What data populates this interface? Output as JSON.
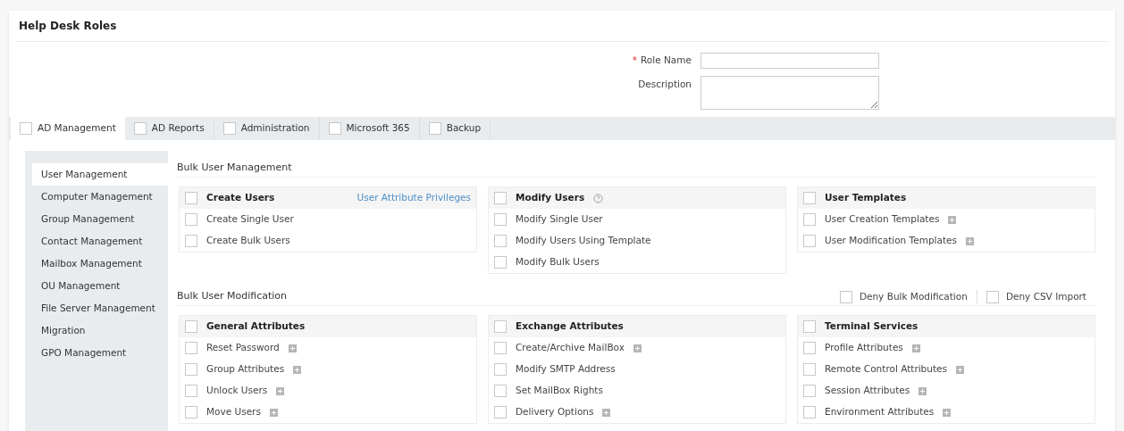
{
  "page_title": "Help Desk Roles",
  "form": {
    "role_name": {
      "label": "Role Name",
      "required_mark": "*"
    },
    "description": {
      "label": "Description"
    }
  },
  "tabs": [
    {
      "label": "AD Management",
      "selected": true,
      "checked": false
    },
    {
      "label": "AD Reports",
      "selected": false,
      "checked": false
    },
    {
      "label": "Administration",
      "selected": false,
      "checked": false
    },
    {
      "label": "Microsoft 365",
      "selected": false,
      "checked": false
    },
    {
      "label": "Backup",
      "selected": false,
      "checked": false
    }
  ],
  "sidebar": {
    "items": [
      {
        "label": "User Management",
        "selected": true
      },
      {
        "label": "Computer Management",
        "selected": false
      },
      {
        "label": "Group Management",
        "selected": false
      },
      {
        "label": "Contact Management",
        "selected": false
      },
      {
        "label": "Mailbox Management",
        "selected": false
      },
      {
        "label": "OU Management",
        "selected": false
      },
      {
        "label": "File Server Management",
        "selected": false
      },
      {
        "label": "Migration",
        "selected": false
      },
      {
        "label": "GPO Management",
        "selected": false
      }
    ]
  },
  "sections": [
    {
      "title": "Bulk User Management",
      "groups": [
        {
          "title": "Create Users",
          "checked": false,
          "help": false,
          "link": "User Attribute Privileges",
          "items": [
            {
              "label": "Create Single User",
              "checked": false,
              "expandable": false
            },
            {
              "label": "Create Bulk Users",
              "checked": false,
              "expandable": false
            }
          ]
        },
        {
          "title": "Modify Users",
          "checked": false,
          "help": true,
          "items": [
            {
              "label": "Modify Single User",
              "checked": false,
              "expandable": false
            },
            {
              "label": "Modify Users Using Template",
              "checked": false,
              "expandable": false
            },
            {
              "label": "Modify Bulk Users",
              "checked": false,
              "expandable": false
            }
          ]
        },
        {
          "title": "User Templates",
          "checked": false,
          "help": false,
          "items": [
            {
              "label": "User Creation Templates",
              "checked": false,
              "expandable": true
            },
            {
              "label": "User Modification Templates",
              "checked": false,
              "expandable": true
            }
          ]
        }
      ]
    },
    {
      "title": "Bulk User Modification",
      "options": [
        {
          "label": "Deny Bulk Modification",
          "checked": false
        },
        {
          "label": "Deny CSV Import",
          "checked": false
        }
      ],
      "groups": [
        {
          "title": "General Attributes",
          "checked": false,
          "help": false,
          "items": [
            {
              "label": "Reset Password",
              "checked": false,
              "expandable": true
            },
            {
              "label": "Group Attributes",
              "checked": false,
              "expandable": true
            },
            {
              "label": "Unlock Users",
              "checked": false,
              "expandable": true
            },
            {
              "label": "Move Users",
              "checked": false,
              "expandable": true
            }
          ]
        },
        {
          "title": "Exchange Attributes",
          "checked": false,
          "help": false,
          "items": [
            {
              "label": "Create/Archive MailBox",
              "checked": false,
              "expandable": true
            },
            {
              "label": "Modify SMTP Address",
              "checked": false,
              "expandable": false
            },
            {
              "label": "Set MailBox Rights",
              "checked": false,
              "expandable": false
            },
            {
              "label": "Delivery Options",
              "checked": false,
              "expandable": true
            }
          ]
        },
        {
          "title": "Terminal Services",
          "checked": false,
          "help": false,
          "items": [
            {
              "label": "Profile Attributes",
              "checked": false,
              "expandable": true
            },
            {
              "label": "Remote Control Attributes",
              "checked": false,
              "expandable": true
            },
            {
              "label": "Session Attributes",
              "checked": false,
              "expandable": true
            },
            {
              "label": "Environment Attributes",
              "checked": false,
              "expandable": true
            }
          ]
        }
      ]
    }
  ]
}
